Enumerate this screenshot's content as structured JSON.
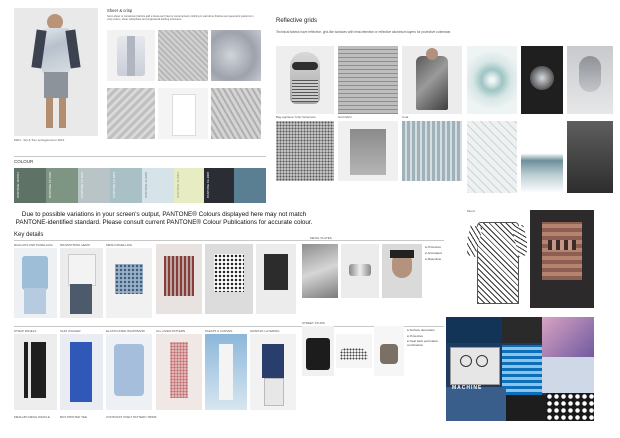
{
  "sheer": {
    "title": "Sheer & crisp",
    "desc": "Semi-sheer or translucent fabrics add a future-tech feel to contemporary clothing in well-done finishes and geometric patterns in crisp cotton, sheer cellophane and engineered knitting structures.",
    "caption": "MAN - Sip & Tom springsummer 2012"
  },
  "reflective": {
    "title": "Reflective grids",
    "desc": "Technical fabrics have reflective, grid-like surfaces with heat-retentive or reflective aluminium layers for protective outerwear.",
    "captions": [
      "Bag appliqué Yohji Yamamoto",
      "Grid fabric",
      "Coat"
    ]
  },
  "colour": {
    "title": "COLOUR",
    "swatches": [
      {
        "label": "PANTONE 18-5611",
        "color": "#5e7365"
      },
      {
        "label": "PANTONE 15-6310",
        "color": "#7e9584"
      },
      {
        "label": "PANTONE 14-4102",
        "color": "#b9c4c6"
      },
      {
        "label": "PANTONE 14-4203",
        "color": "#a9c0c6"
      },
      {
        "label": "PANTONE 11-0205",
        "color": "#d6e3e9"
      },
      {
        "label": "PANTONE 11-0601",
        "color": "#e8ecc3"
      },
      {
        "label": "PANTONE 19-4008",
        "color": "#2a2d34"
      },
      {
        "label": "",
        "color": "#5b7f92"
      }
    ]
  },
  "disclaimer": "Due to possible variations in your screen's output, PANTONE® Colours displayed here may not match PANTONE-identified standard. Please consult current PANTONE® Colour Publications for accurate colour.",
  "key_details": {
    "title": "Key details",
    "labels_row1": [
      "RAGLANS AND PANELLING",
      "DRAWSTRING HEMS",
      "MESH PANELLING",
      "METAL PLATES"
    ],
    "labels_row2": [
      "STRAP PANELS",
      "SLIM JOGGER",
      "ELASTICATED WAISTBAND",
      "ALL-OVER PATTERN",
      "PLEATS & CURVES",
      "GRAPHIC LAYERING",
      "STREET STUDS"
    ],
    "bottom_labels": [
      "MESH-BY-MESH WAFFLE",
      "BOX PRINTED TEE",
      "CONTRAST INSET PATTERN TRIMS"
    ],
    "bullets_a": [
      "Protective",
      "Articulated",
      "Masculine"
    ],
    "bullets_b": [
      "Surface decoration",
      "Protective",
      "Neat back perforation combination"
    ],
    "watermark": "MACHINE"
  },
  "mood": {
    "label": "Mood"
  }
}
